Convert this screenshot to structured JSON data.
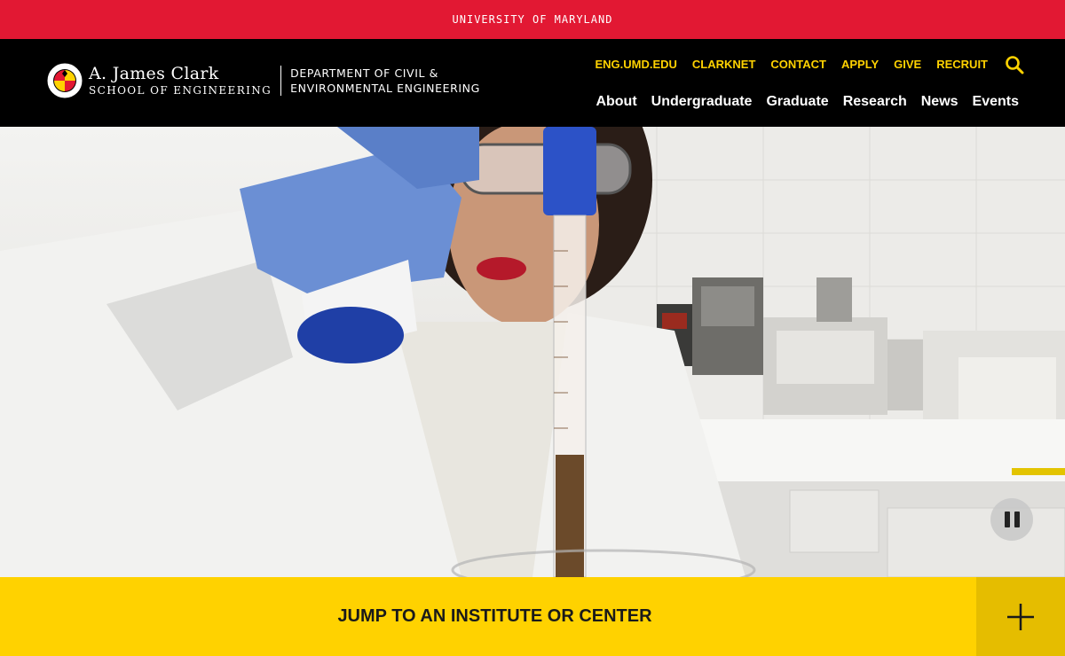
{
  "umd_bar": {
    "label": "UNIVERSITY OF MARYLAND"
  },
  "logo": {
    "line1": "A. James Clark",
    "line2": "SCHOOL OF ENGINEERING",
    "seal_text": "UNIVERSITY OF MARYLAND",
    "dept_line1": "DEPARTMENT OF CIVIL &",
    "dept_line2": "ENVIRONMENTAL ENGINEERING"
  },
  "utility_nav": [
    {
      "label": "ENG.UMD.EDU"
    },
    {
      "label": "CLARKNET"
    },
    {
      "label": "CONTACT"
    },
    {
      "label": "APPLY"
    },
    {
      "label": "GIVE"
    },
    {
      "label": "RECRUIT"
    }
  ],
  "main_nav": [
    {
      "label": "About"
    },
    {
      "label": "Undergraduate"
    },
    {
      "label": "Graduate"
    },
    {
      "label": "Research"
    },
    {
      "label": "News"
    },
    {
      "label": "Events"
    }
  ],
  "hero": {
    "media": "lab-researcher-video",
    "state": "playing"
  },
  "jump_bar": {
    "label": "JUMP TO AN INSTITUTE OR CENTER",
    "toggle_icon": "plus-icon"
  },
  "colors": {
    "umd_red": "#e21833",
    "umd_gold": "#ffd200",
    "header_bg": "#000000"
  },
  "icons": {
    "search": "search-icon",
    "pause": "pause-icon",
    "expand": "plus-icon"
  }
}
